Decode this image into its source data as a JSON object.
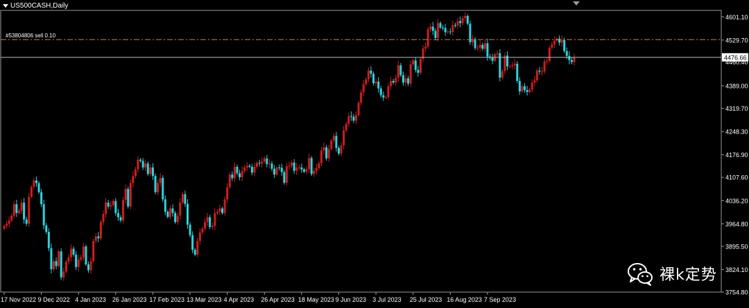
{
  "header": {
    "symbol_label": "US500CASH,Daily"
  },
  "order_line": {
    "label": "#53804806 sell 0.10",
    "price": 4531.0,
    "color": "#d4861c"
  },
  "bid_line": {
    "price": 4476.66,
    "label": "4476.66",
    "price_hidden_behind": "4460.40"
  },
  "watermark": {
    "text": "裸k定势",
    "icon": "wechat-icon"
  },
  "colors": {
    "background": "#000000",
    "bull": "#cc1f1f",
    "bear": "#2ed3de",
    "axis": "#9a9a9a",
    "text": "#ffffff"
  },
  "chart_data": {
    "type": "candlestick",
    "title": "US500CASH,Daily",
    "y_ticks": [
      "4601.10",
      "4529.70",
      "4389.00",
      "4319.70",
      "4248.30",
      "4176.90",
      "4107.60",
      "4036.20",
      "3964.80",
      "3895.50",
      "3824.10",
      "3754.80"
    ],
    "y_tick_values": [
      4601.1,
      4529.7,
      4389.0,
      4319.7,
      4248.3,
      4176.9,
      4107.6,
      4036.2,
      3964.8,
      3895.5,
      3824.1,
      3754.8
    ],
    "x_ticks": [
      "17 Nov 2022",
      "9 Dec 2022",
      "4 Jan 2023",
      "26 Jan 2023",
      "17 Feb 2023",
      "13 Mar 2023",
      "4 Apr 2023",
      "26 Apr 2023",
      "18 May 2023",
      "9 Jun 2023",
      "3 Jul 2023",
      "25 Jul 2023",
      "16 Aug 2023",
      "7 Sep 2023"
    ],
    "x_tick_index": [
      0,
      15,
      30,
      45,
      60,
      75,
      90,
      105,
      120,
      135,
      150,
      165,
      180,
      195
    ],
    "ylim": [
      3754.8,
      4621
    ],
    "close": [
      3958,
      3965,
      3975,
      3990,
      4025,
      3998,
      4005,
      4030,
      3978,
      3965,
      4048,
      4078,
      4098,
      4090,
      4062,
      4025,
      3960,
      3940,
      3890,
      3825,
      3850,
      3835,
      3880,
      3800,
      3818,
      3848,
      3862,
      3888,
      3870,
      3832,
      3855,
      3862,
      3895,
      3840,
      3822,
      3850,
      3912,
      3926,
      3920,
      3970,
      3995,
      4030,
      4018,
      4022,
      4035,
      3998,
      3985,
      3975,
      4038,
      4072,
      4018,
      4090,
      4112,
      4132,
      4162,
      4158,
      4138,
      4150,
      4118,
      4138,
      4112,
      4062,
      4090,
      4106,
      4040,
      4002,
      3986,
      4012,
      3998,
      3970,
      3990,
      4030,
      4056,
      4026,
      3962,
      3930,
      3885,
      3870,
      3912,
      3938,
      3950,
      3970,
      3985,
      3955,
      3958,
      3998,
      4002,
      4012,
      3998,
      4040,
      4077,
      4116,
      4105,
      4140,
      4120,
      4108,
      4127,
      4138,
      4143,
      4140,
      4122,
      4140,
      4152,
      4150,
      4156,
      4166,
      4148,
      4150,
      4134,
      4116,
      4138,
      4137,
      4124,
      4091,
      4142,
      4143,
      4153,
      4128,
      4138,
      4138,
      4132,
      4125,
      4133,
      4167,
      4118,
      4128,
      4136,
      4151,
      4190,
      4200,
      4166,
      4195,
      4221,
      4235,
      4198,
      4181,
      4206,
      4252,
      4272,
      4296,
      4294,
      4282,
      4299,
      4337,
      4369,
      4394,
      4409,
      4436,
      4426,
      4397,
      4402,
      4381,
      4360,
      4353,
      4354,
      4388,
      4404,
      4399,
      4413,
      4452,
      4422,
      4399,
      4412,
      4396,
      4455,
      4467,
      4438,
      4429,
      4472,
      4504,
      4509,
      4563,
      4571,
      4558,
      4536,
      4582,
      4568,
      4567,
      4554,
      4556,
      4555,
      4576,
      4574,
      4588,
      4582,
      4597,
      4604,
      4580,
      4523,
      4533,
      4505,
      4506,
      4515,
      4503,
      4520,
      4479,
      4476,
      4466,
      4486,
      4489,
      4414,
      4434,
      4482,
      4449,
      4449,
      4452,
      4457,
      4404,
      4372,
      4388,
      4376,
      4370,
      4377,
      4399,
      4406,
      4436,
      4433,
      4433,
      4464,
      4465,
      4506,
      4516,
      4528,
      4534,
      4522,
      4530,
      4496,
      4481,
      4468,
      4462,
      4476
    ]
  }
}
